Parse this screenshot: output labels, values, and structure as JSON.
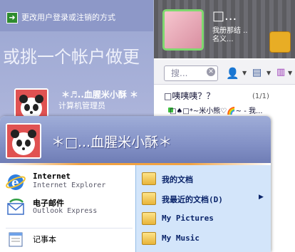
{
  "login": {
    "switch_link": "更改用户登录或注销的方式",
    "prompt": "或挑一个帐户做更",
    "user_name": "＊♬..血腥米小酥 ＊",
    "user_role": "计算机管理员"
  },
  "messenger": {
    "display_name": "□...",
    "status_text": "我册那结 ..",
    "status_text2": "名义...",
    "search_placeholder": "搜...",
    "group_label": "□咦咦咦？？",
    "group_count": "(1/1)",
    "contact": "□♠□*~米小熊♡🌈~ - 我..."
  },
  "start_menu": {
    "user_name": "＊□...血腥米小酥＊",
    "pinned": [
      {
        "title": "Internet",
        "subtitle": "Internet Explorer",
        "icon": "internet-explorer-icon"
      },
      {
        "title": "电子邮件",
        "subtitle": "Outlook Express",
        "icon": "outlook-express-icon"
      },
      {
        "title": "记事本",
        "subtitle": "",
        "icon": "notepad-icon"
      }
    ],
    "places": [
      {
        "label": "我的文档",
        "icon": "my-documents-icon",
        "has_arrow": false
      },
      {
        "label": "我最近的文档(D)",
        "icon": "recent-documents-icon",
        "has_arrow": true
      },
      {
        "label": "My Pictures",
        "icon": "my-pictures-icon",
        "has_arrow": false
      },
      {
        "label": "My Music",
        "icon": "my-music-icon",
        "has_arrow": false
      }
    ]
  },
  "colors": {
    "login_bg": "#a8b3d4",
    "startmenu_header": "#8391c6",
    "places_pane": "#d3e5fa",
    "accent_orange": "#f2a341"
  }
}
